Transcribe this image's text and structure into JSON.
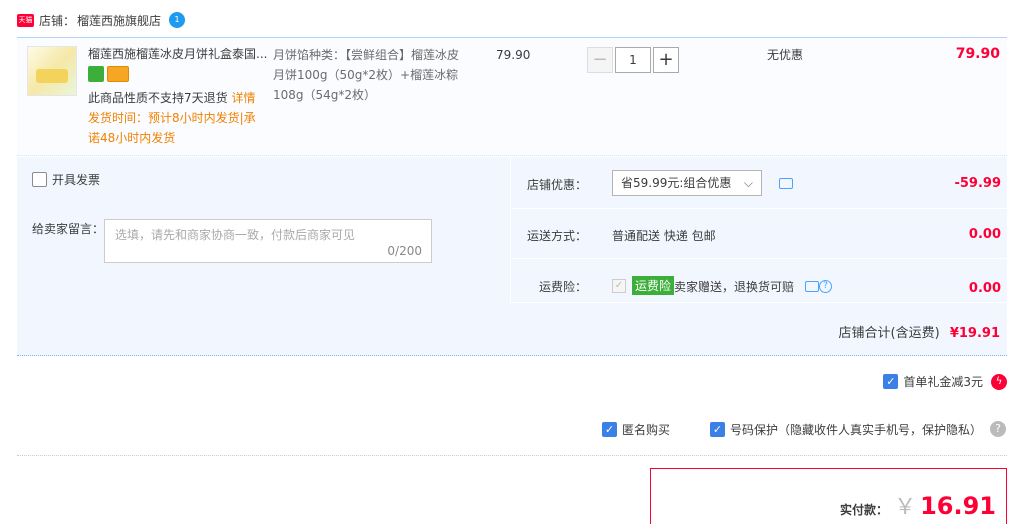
{
  "shop": {
    "badge": "天猫",
    "label": "店铺：",
    "name": "榴莲西施旗舰店",
    "chat_badge": "1"
  },
  "item": {
    "title": "榴莲西施榴莲冰皮月饼礼盒泰国...",
    "return_note": "此商品性质不支持7天退货",
    "detail_link": "详情",
    "ship_time": "发货时间：预计8小时内发货|承诺48小时内发货",
    "sku": "月饼馅种类：【尝鲜组合】榴莲冰皮月饼100g（50g*2枚）+榴莲冰粽108g（54g*2枚）",
    "unit_price": "79.90",
    "quantity": "1",
    "qty_minus": "−",
    "qty_plus": "+",
    "promo": "无优惠",
    "subtotal": "79.90"
  },
  "options": {
    "invoice_label": "开具发票",
    "message_label": "给卖家留言：",
    "message_placeholder": "选填，请先和商家协商一致，付款后商家可见",
    "message_count": "0/200",
    "shop_discount_label": "店铺优惠：",
    "shop_discount_value": "省59.99元:组合优惠",
    "shop_discount_amount": "-59.99",
    "shipping_label": "运送方式：",
    "shipping_value": "普通配送 快递 包邮",
    "shipping_amount": "0.00",
    "insurance_label": "运费险：",
    "insurance_tag": "运费险",
    "insurance_text": "卖家赠送，退换货可赔",
    "insurance_amount": "0.00",
    "shop_total_label": "店铺合计(含运费)",
    "shop_total_value": "¥19.91"
  },
  "footer": {
    "first_gift": "首单礼金减3元",
    "anonymous": "匿名购买",
    "phone_protect": "号码保护（隐藏收件人真实手机号，保护隐私）",
    "pay_label": "实付款：",
    "pay_currency": "￥",
    "pay_amount": "16.91"
  },
  "colors": {
    "accent": "#ff0036",
    "link_orange": "#f08200",
    "checkbox_blue": "#3a80e6",
    "row_bg": "#f2f7ff"
  }
}
